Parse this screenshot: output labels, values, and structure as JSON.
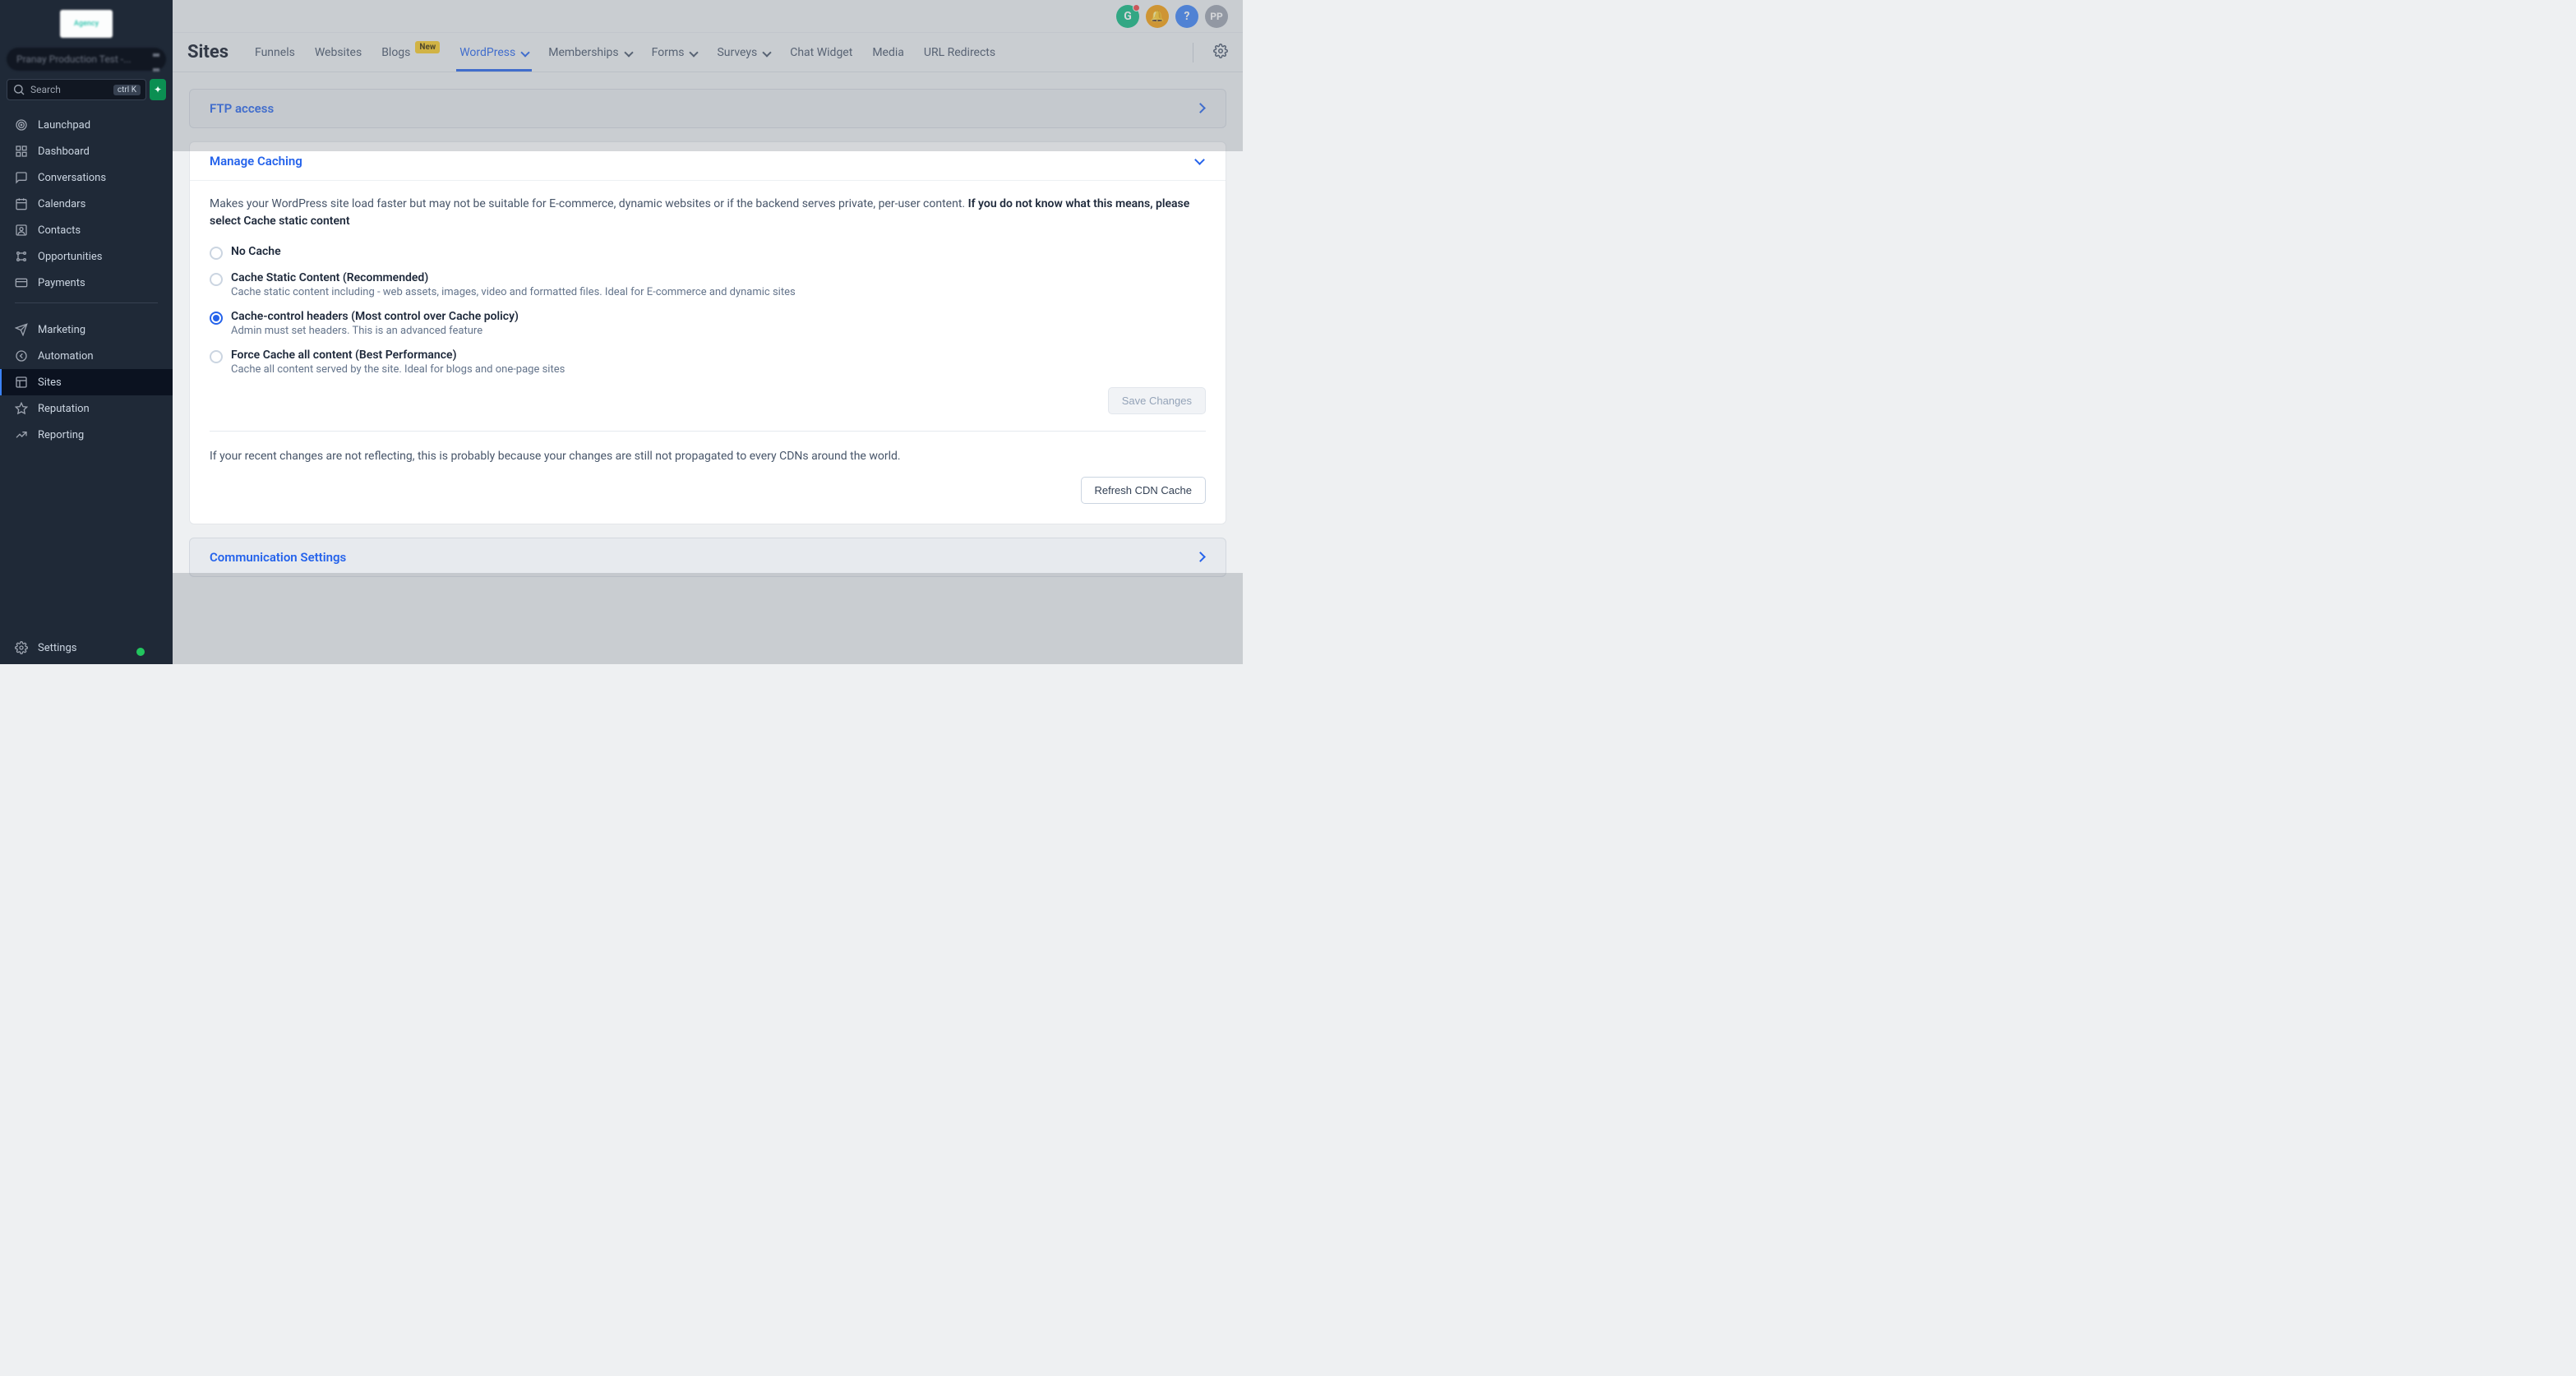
{
  "sidebar": {
    "logo_text": "Agency",
    "account_label": "Pranay Production Test -...",
    "search_placeholder": "Search",
    "search_shortcut": "ctrl K",
    "items_top": [
      {
        "label": "Launchpad",
        "icon": "target-icon"
      },
      {
        "label": "Dashboard",
        "icon": "grid-icon"
      },
      {
        "label": "Conversations",
        "icon": "chat-icon"
      },
      {
        "label": "Calendars",
        "icon": "calendar-icon"
      },
      {
        "label": "Contacts",
        "icon": "contact-icon"
      },
      {
        "label": "Opportunities",
        "icon": "opportunity-icon"
      },
      {
        "label": "Payments",
        "icon": "payments-icon"
      }
    ],
    "items_mid": [
      {
        "label": "Marketing",
        "icon": "send-icon"
      },
      {
        "label": "Automation",
        "icon": "automation-icon"
      },
      {
        "label": "Sites",
        "icon": "sites-icon",
        "active": true
      },
      {
        "label": "Reputation",
        "icon": "star-icon"
      },
      {
        "label": "Reporting",
        "icon": "trend-icon"
      }
    ],
    "settings_label": "Settings"
  },
  "header_icons": {
    "green_glyph": "G",
    "bell_glyph": "🔔",
    "help_glyph": "?",
    "avatar_initials": "PP"
  },
  "subnav": {
    "brand": "Sites",
    "tabs": [
      {
        "label": "Funnels",
        "dropdown": false
      },
      {
        "label": "Websites",
        "dropdown": false
      },
      {
        "label": "Blogs",
        "dropdown": false,
        "badge": "New"
      },
      {
        "label": "WordPress",
        "dropdown": true,
        "active": true
      },
      {
        "label": "Memberships",
        "dropdown": true
      },
      {
        "label": "Forms",
        "dropdown": true
      },
      {
        "label": "Surveys",
        "dropdown": true
      },
      {
        "label": "Chat Widget",
        "dropdown": false
      },
      {
        "label": "Media",
        "dropdown": false
      },
      {
        "label": "URL Redirects",
        "dropdown": false
      }
    ]
  },
  "cards": {
    "ftp_title": "FTP access",
    "caching": {
      "title": "Manage Caching",
      "desc_plain": "Makes your WordPress site load faster but may not be suitable for E-commerce, dynamic websites or if the backend serves private, per-user content. ",
      "desc_bold": "If you do not know what this means, please select Cache static content",
      "options": [
        {
          "label": "No Cache",
          "sub": "",
          "selected": false
        },
        {
          "label": "Cache Static Content (Recommended)",
          "sub": "Cache static content including - web assets, images, video and formatted files. Ideal for E-commerce and dynamic sites",
          "selected": false
        },
        {
          "label": "Cache-control headers (Most control over Cache policy)",
          "sub": "Admin must set headers. This is an advanced feature",
          "selected": true
        },
        {
          "label": "Force Cache all content (Best Performance)",
          "sub": "Cache all content served by the site. Ideal for blogs and one-page sites",
          "selected": false
        }
      ],
      "save_label": "Save Changes",
      "cdn_note": "If your recent changes are not reflecting, this is probably because your changes are still not propagated to every CDNs around the world.",
      "refresh_label": "Refresh CDN Cache"
    },
    "comm_title": "Communication Settings"
  }
}
